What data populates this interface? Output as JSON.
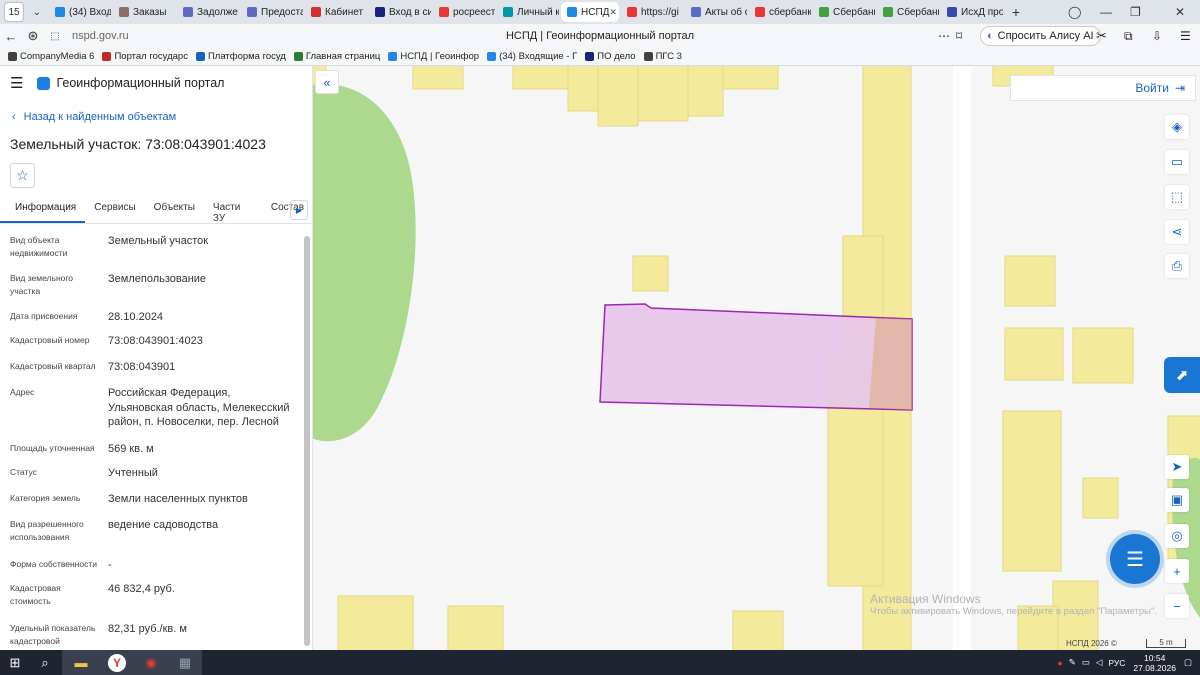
{
  "browser": {
    "tab_count": "15",
    "tabs": [
      {
        "label": "(34) Входя",
        "color": "#1e88e5"
      },
      {
        "label": "Заказы",
        "color": "#8d6e63"
      },
      {
        "label": "Задолже",
        "color": "#5c6bc0"
      },
      {
        "label": "Предоста",
        "color": "#5c6bc0"
      },
      {
        "label": "Кабинет",
        "color": "#d32f2f"
      },
      {
        "label": "Вход в си",
        "color": "#1a237e"
      },
      {
        "label": "росреест",
        "color": "#e53935"
      },
      {
        "label": "Личный к",
        "color": "#0097a7"
      },
      {
        "label": "НСПД",
        "color": "#1e88e5",
        "active": true
      },
      {
        "label": "https://gi",
        "color": "#e53935"
      },
      {
        "label": "Акты об с",
        "color": "#5c6bc0"
      },
      {
        "label": "сбербанк",
        "color": "#e53935"
      },
      {
        "label": "Сбербанк",
        "color": "#43a047"
      },
      {
        "label": "Сбербанк",
        "color": "#43a047"
      },
      {
        "label": "ИсхД про",
        "color": "#3949ab"
      }
    ],
    "url": "nspd.gov.ru",
    "page_title": "НСПД | Геоинформационный портал",
    "alice_label": "Спросить Алису AI",
    "bookmarks": [
      {
        "label": "CompanyMedia 6",
        "color": "#424242"
      },
      {
        "label": "Портал государс",
        "color": "#c62828"
      },
      {
        "label": "Платформа госуд",
        "color": "#1565c0"
      },
      {
        "label": "Главная страниц",
        "color": "#2e7d32"
      },
      {
        "label": "НСПД | Геоинфор",
        "color": "#1e88e5"
      },
      {
        "label": "(34) Входящие - Г",
        "color": "#1e88e5"
      },
      {
        "label": "ПО дело",
        "color": "#1a237e"
      },
      {
        "label": "ПГС 3",
        "color": "#424242"
      }
    ]
  },
  "panel": {
    "portal_name": "Геоинформационный портал",
    "back_link": "Назад к найденным объектам",
    "object_title": "Земельный участок: 73:08:043901:4023",
    "tabs": [
      "Информация",
      "Сервисы",
      "Объекты",
      "Части ЗУ",
      "Состав"
    ],
    "properties": [
      {
        "label": "Вид объекта недвижимости",
        "value": "Земельный участок"
      },
      {
        "label": "Вид земельного участка",
        "value": "Землепользование"
      },
      {
        "label": "Дата присвоения",
        "value": "28.10.2024"
      },
      {
        "label": "Кадастровый номер",
        "value": "73:08:043901:4023"
      },
      {
        "label": "Кадастровый квартал",
        "value": "73:08:043901"
      },
      {
        "label": "Адрес",
        "value": "Российская Федерация, Ульяновская область, Мелекесский район, п. Новоселки, пер. Лесной"
      },
      {
        "label": "Площадь уточненная",
        "value": "569 кв. м"
      },
      {
        "label": "Статус",
        "value": "Учтенный"
      },
      {
        "label": "Категория земель",
        "value": "Земли населенных пунктов"
      },
      {
        "label": "Вид разрешенного использования",
        "value": "ведение садоводства"
      },
      {
        "label": "Форма собственности",
        "value": "-"
      },
      {
        "label": "Кадастровая стоимость",
        "value": "46 832,4 руб."
      },
      {
        "label": "Удельный показатель кадастровой",
        "value": "82,31 руб./кв. м"
      }
    ]
  },
  "map": {
    "login_label": "Войти",
    "watermark_title": "Активация Windows",
    "watermark_text": "Чтобы активировать Windows, перейдите в раздел \"Параметры\".",
    "attribution": "НСПД 2026 ©",
    "scale_label": "5 m",
    "colors": {
      "building": "#f3eb9b",
      "greenery": "#acd98e",
      "parcel_fill": "#e8c4ea",
      "parcel_stroke": "#9c27b0"
    }
  },
  "taskbar": {
    "lang": "РУС",
    "time": "10:54",
    "date": "27.08.2026"
  }
}
